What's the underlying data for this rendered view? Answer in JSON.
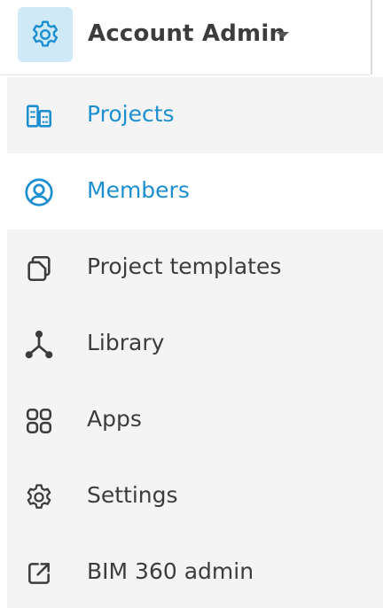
{
  "header": {
    "title": "Account Admin",
    "icon": "gear-icon",
    "accent_bg": "#cfe9f7",
    "accent": "#1c8fd1"
  },
  "nav": {
    "items": [
      {
        "label": "Projects",
        "icon": "buildings-icon",
        "state": "highlighted"
      },
      {
        "label": "Members",
        "icon": "user-circle-icon",
        "state": "selected"
      },
      {
        "label": "Project templates",
        "icon": "copy-icon",
        "state": "default"
      },
      {
        "label": "Library",
        "icon": "network-icon",
        "state": "default"
      },
      {
        "label": "Apps",
        "icon": "apps-grid-icon",
        "state": "default"
      },
      {
        "label": "Settings",
        "icon": "gear-icon",
        "state": "default"
      },
      {
        "label": "BIM 360 admin",
        "icon": "external-link-icon",
        "state": "default"
      }
    ]
  }
}
